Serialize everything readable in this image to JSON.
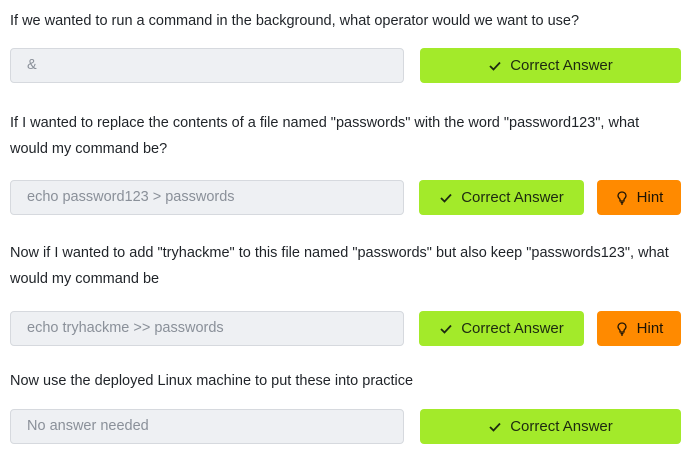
{
  "questions": [
    {
      "text": "If we wanted to run a command in the background, what operator would we want to use?",
      "answer": "&",
      "correct_label": "Correct Answer"
    },
    {
      "text": "If I wanted to replace the contents of a file named \"passwords\" with the word \"password123\", what would my command be?",
      "answer": "echo password123 > passwords",
      "correct_label": "Correct Answer",
      "hint_label": "Hint"
    },
    {
      "text": "Now if I wanted to add \"tryhackme\" to this file named \"passwords\" but also keep \"passwords123\", what would my command be",
      "answer": "echo tryhackme >> passwords",
      "correct_label": "Correct Answer",
      "hint_label": "Hint"
    },
    {
      "text": "Now use the deployed Linux machine to put these into practice",
      "answer": "No answer needed",
      "correct_label": "Correct Answer"
    }
  ],
  "icons": {
    "correct": "check-icon",
    "hint": "lightbulb-icon"
  },
  "colors": {
    "correct_button": "#a3ea2a",
    "hint_button": "#ff8a00",
    "input_background": "#eef0f3"
  }
}
